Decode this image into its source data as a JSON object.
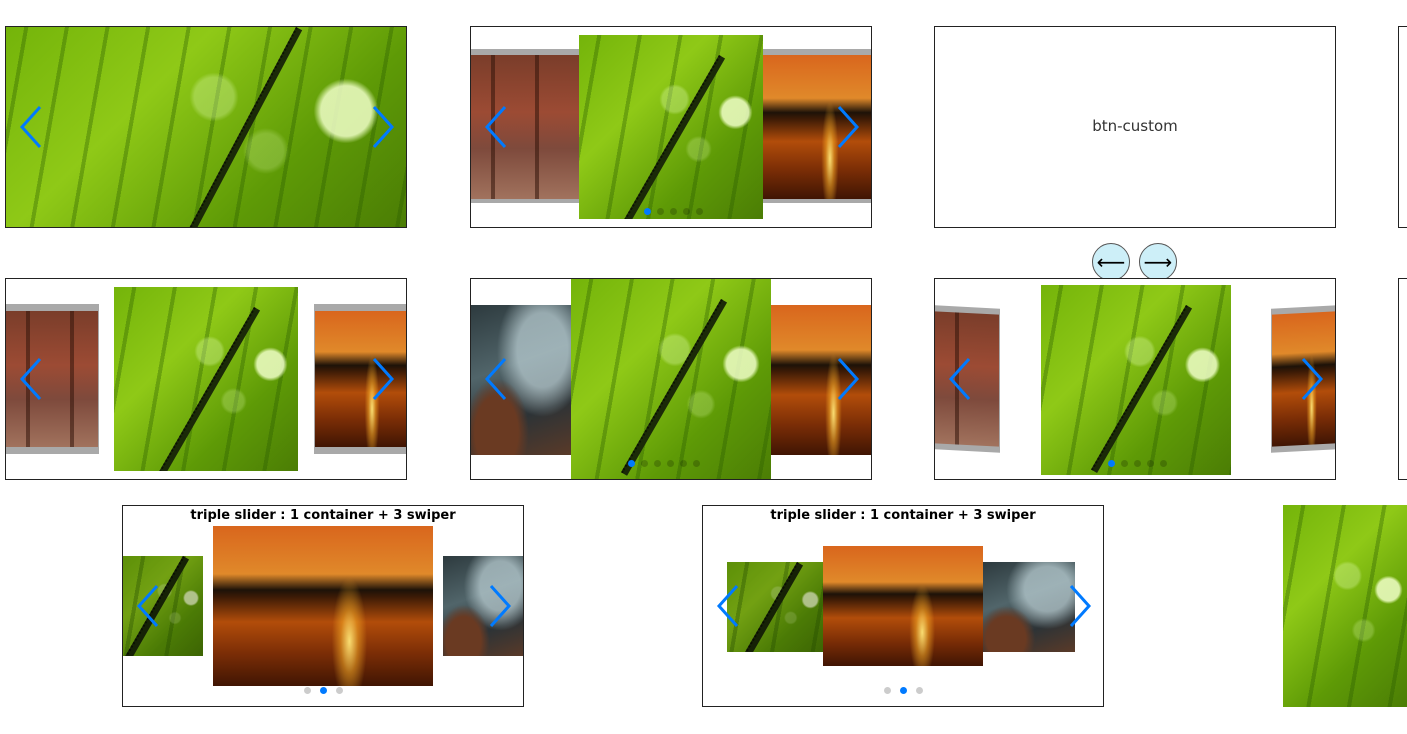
{
  "btn_custom": {
    "label": "btn-custom"
  },
  "custom_nav": {
    "prev_glyph": "⟵",
    "next_glyph": "⟶"
  },
  "triple_slider_1": {
    "title": "triple slider : 1 container + 3 swiper"
  },
  "triple_slider_2": {
    "title": "triple slider : 1 container + 3 swiper"
  },
  "colors": {
    "accent": "#007aff",
    "nav_circle": "#cdeff8"
  },
  "icons": {
    "prev": "chevron-left-icon",
    "next": "chevron-right-icon"
  }
}
